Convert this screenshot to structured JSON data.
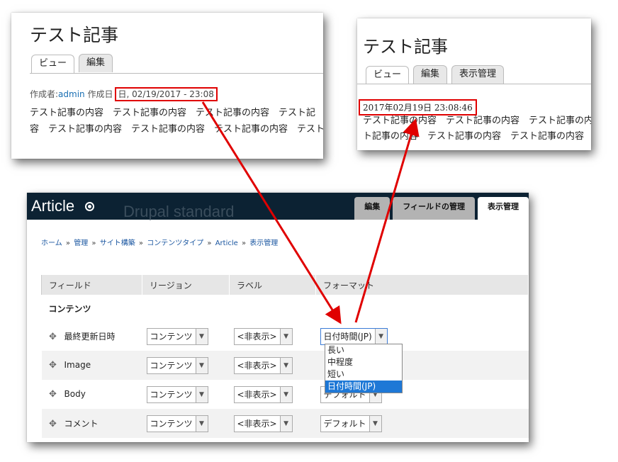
{
  "left_article": {
    "title": "テスト記事",
    "tabs": [
      "ビュー",
      "編集"
    ],
    "meta_prefix": "作成者:",
    "meta_author": "admin",
    "meta_created_label": "作成日",
    "meta_date": "日, 02/19/2017 - 23:08",
    "body_line1": "テスト記事の内容　テスト記事の内容　テスト記事の内容　テスト記",
    "body_line2": "容　テスト記事の内容　テスト記事の内容　テスト記事の内容　テスト"
  },
  "right_article": {
    "title": "テスト記事",
    "tabs": [
      "ビュー",
      "編集",
      "表示管理"
    ],
    "date": "2017年02月19日 23:08:46",
    "body_line1": "テスト記事の内容　テスト記事の内容　テスト記事の内容",
    "body_line2": "ト記事の内容　テスト記事の内容　テスト記事の内容　テス"
  },
  "admin": {
    "app_title": "Article",
    "ghost_text": "Drupal standard",
    "tabs": [
      "編集",
      "フィールドの管理",
      "表示管理"
    ],
    "breadcrumb": [
      "ホーム",
      "管理",
      "サイト構築",
      "コンテンツタイプ",
      "Article",
      "表示管理"
    ],
    "breadcrumb_sep": "»",
    "columns": [
      "フィールド",
      "リージョン",
      "ラベル",
      "フォーマット"
    ],
    "group_label": "コンテンツ",
    "rows": [
      {
        "field": "最終更新日時",
        "region": "コンテンツ",
        "label": "<非表示>",
        "format": "日付時間(JP)"
      },
      {
        "field": "Image",
        "region": "コンテンツ",
        "label": "<非表示>",
        "format": ""
      },
      {
        "field": "Body",
        "region": "コンテンツ",
        "label": "<非表示>",
        "format": "デフォルト"
      },
      {
        "field": "コメント",
        "region": "コンテンツ",
        "label": "<非表示>",
        "format": "デフォルト"
      }
    ],
    "format_options": [
      "長い",
      "中程度",
      "短い",
      "日付時間(JP)"
    ],
    "selected_option": "日付時間(JP)"
  },
  "colors": {
    "highlight": "#e00000",
    "header_bg": "#0c2233",
    "link": "#1a56a0",
    "selected_bg": "#1e78d6"
  }
}
